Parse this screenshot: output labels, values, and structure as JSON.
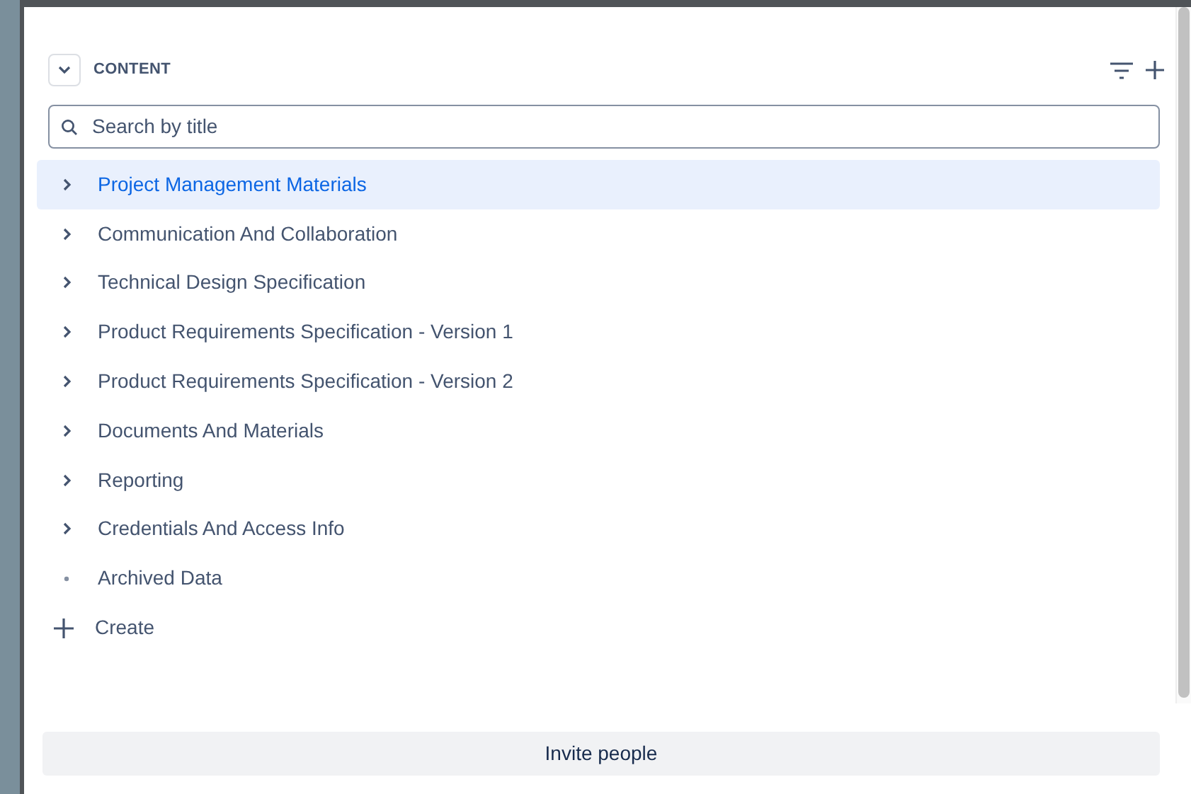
{
  "section": {
    "title": "CONTENT",
    "expanded": true
  },
  "search": {
    "placeholder": "Search by title"
  },
  "tree": [
    {
      "label": "Project Management Materials",
      "kind": "folder",
      "selected": true
    },
    {
      "label": "Communication And Collaboration",
      "kind": "folder",
      "selected": false
    },
    {
      "label": "Technical Design Specification",
      "kind": "folder",
      "selected": false
    },
    {
      "label": "Product Requirements Specification - Version 1",
      "kind": "folder",
      "selected": false
    },
    {
      "label": "Product Requirements Specification - Version 2",
      "kind": "folder",
      "selected": false
    },
    {
      "label": "Documents And Materials",
      "kind": "folder",
      "selected": false
    },
    {
      "label": "Reporting",
      "kind": "folder",
      "selected": false
    },
    {
      "label": "Credentials And Access Info",
      "kind": "folder",
      "selected": false
    },
    {
      "label": "Archived Data",
      "kind": "page",
      "selected": false
    }
  ],
  "create": {
    "label": "Create"
  },
  "invite_button": {
    "label": "Invite people"
  }
}
